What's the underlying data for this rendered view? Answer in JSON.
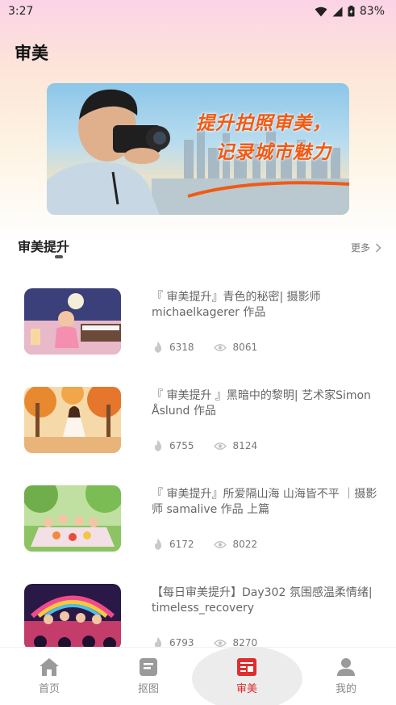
{
  "status_bar": {
    "time": "3:27",
    "battery": "83%"
  },
  "app": {
    "title": "审美"
  },
  "banner": {
    "line1": "提升拍照审美，",
    "line2": "记录城市魅力"
  },
  "section": {
    "title": "审美提升",
    "more_label": "更多"
  },
  "articles": [
    {
      "title": "『 审美提升』青色的秘密| 摄影师michaelkagerer 作品",
      "likes": "6318",
      "views": "8061"
    },
    {
      "title": "『 审美提升 』黑暗中的黎明| 艺术家Simon Åslund 作品",
      "likes": "6755",
      "views": "8124"
    },
    {
      "title": "『 审美提升』所爱隔山海 山海皆不平 ｜摄影师 samalive 作品 上篇",
      "likes": "6172",
      "views": "8022"
    },
    {
      "title": "【每日审美提升】Day302 氛围感温柔情绪| timeless_recovery",
      "likes": "6793",
      "views": "8270"
    }
  ],
  "tabs": [
    {
      "label": "首页",
      "icon": "home-icon"
    },
    {
      "label": "抠图",
      "icon": "document-icon"
    },
    {
      "label": "审美",
      "icon": "aesthetics-icon",
      "active": true
    },
    {
      "label": "我的",
      "icon": "profile-icon"
    }
  ],
  "colors": {
    "accent": "#e02d2d",
    "banner_text": "#f15a14"
  }
}
